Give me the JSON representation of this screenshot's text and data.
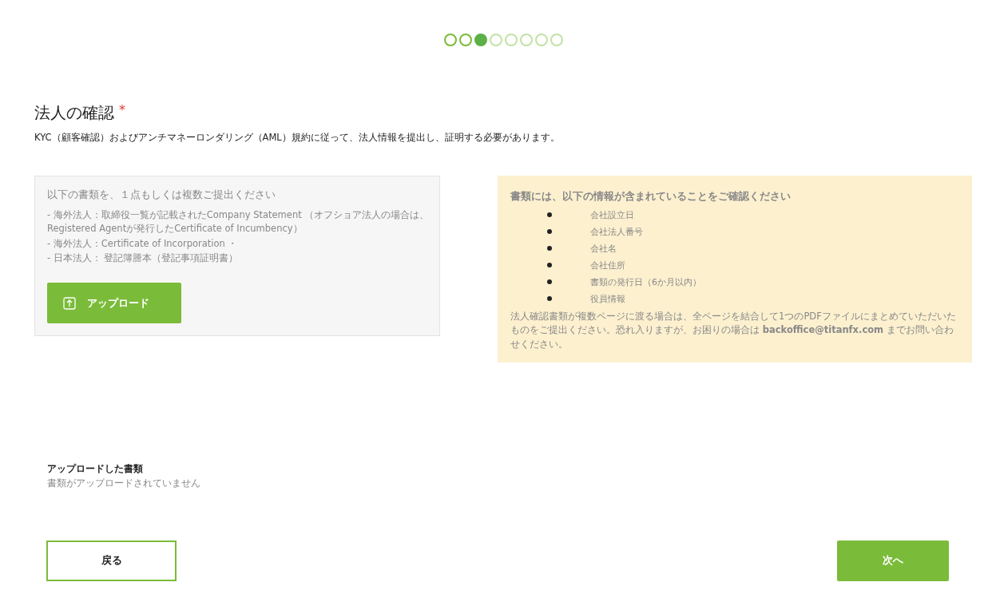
{
  "steps": [
    {
      "kind": "done"
    },
    {
      "kind": "done"
    },
    {
      "kind": "current"
    },
    {
      "kind": "pending"
    },
    {
      "kind": "pending"
    },
    {
      "kind": "pending"
    },
    {
      "kind": "pending"
    },
    {
      "kind": "pending"
    }
  ],
  "heading": {
    "title": "法人の確認",
    "required_mark": "*"
  },
  "description": "KYC（顧客確認）およびアンチマネーロンダリング（AML）規約に従って、法人情報を提出し、証明する必要があります。",
  "upload_panel": {
    "title": "以下の書類を、１点もしくは複数ご提出ください",
    "documents": [
      "- 海外法人：取締役一覧が記載されたCompany Statement （オフショア法人の場合は、Registered Agentが発行したCertificate of Incumbency）",
      "- 海外法人：Certificate of Incorporation ・",
      "- 日本法人： 登記簿謄本（登記事項証明書）"
    ],
    "button": "アップロード"
  },
  "info_panel": {
    "title": "書類には、以下の情報が含まれていることをご確認ください",
    "items": [
      "会社設立日",
      "会社法人番号",
      "会社名",
      "会社住所",
      "書類の発行日（6か月以内）",
      "役員情報"
    ],
    "note": "法人確認書類が複数ページに渡る場合は、全ページを結合して1つのPDFファイルにまとめていただいたものをご提出ください。恐れ入りますが、お困りの場合は **backoffice@titanfx.com** までお問い合わせください。"
  },
  "uploaded": {
    "title": "アップロードした書類",
    "empty_text": "書類がアップロードされていません"
  },
  "buttons": {
    "back": "戻る",
    "next": "次へ"
  }
}
